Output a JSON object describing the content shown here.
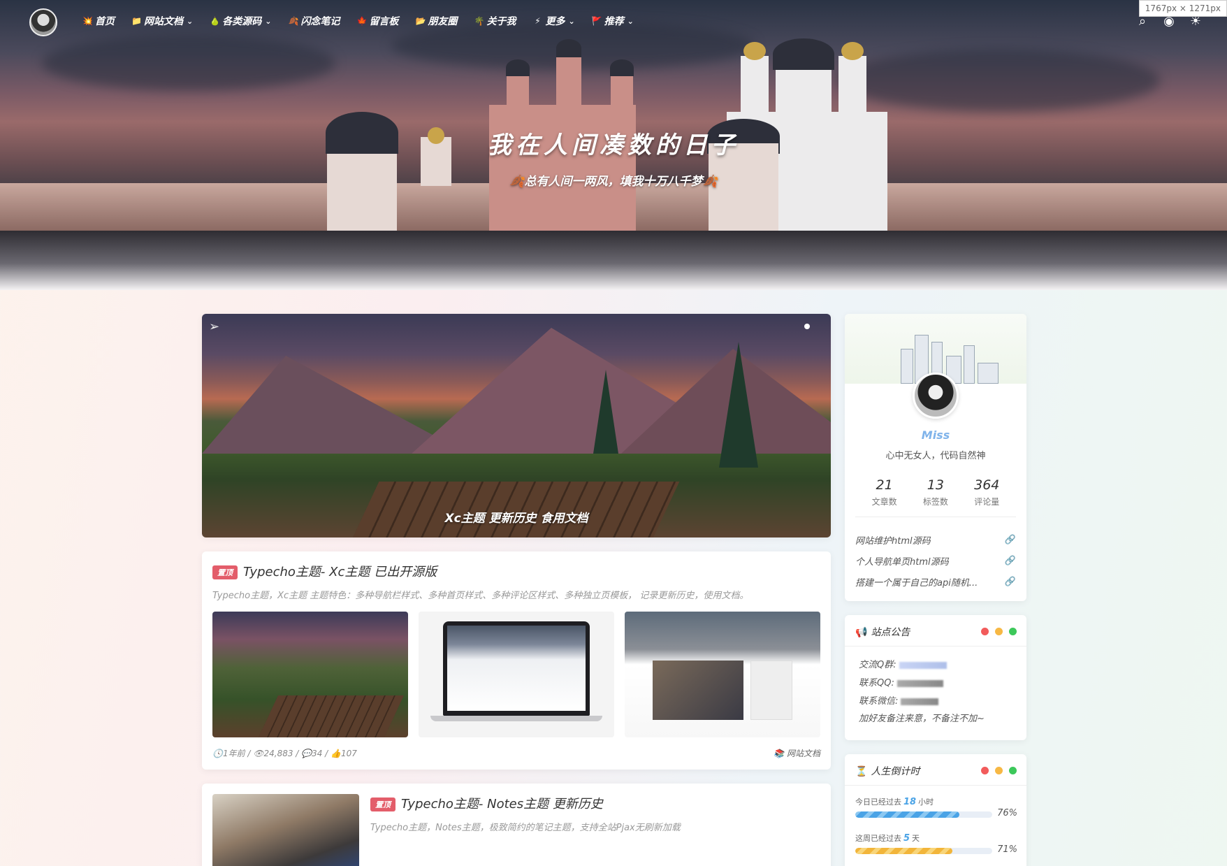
{
  "nav": {
    "items": [
      {
        "label": "首页",
        "icon": "💥",
        "dropdown": false
      },
      {
        "label": "网站文档",
        "icon": "📁",
        "dropdown": true
      },
      {
        "label": "各类源码",
        "icon": "🍐",
        "dropdown": true
      },
      {
        "label": "闪念笔记",
        "icon": "🍂",
        "dropdown": false
      },
      {
        "label": "留言板",
        "icon": "🍁",
        "dropdown": false
      },
      {
        "label": "朋友圈",
        "icon": "📂",
        "dropdown": false
      },
      {
        "label": "关于我",
        "icon": "🌴",
        "dropdown": false
      },
      {
        "label": "更多",
        "icon": "⚡",
        "dropdown": true
      },
      {
        "label": "推荐",
        "icon": "🚩",
        "dropdown": true
      }
    ],
    "chevron": "⌄",
    "tools": {
      "search": "⌕",
      "user": "◉",
      "theme": "☀"
    },
    "size_chip": "1767px × 1271px"
  },
  "hero": {
    "title": "我在人间凑数的日子",
    "subtitle": "🍂总有人间一两风，填我十万八千梦🍂"
  },
  "banner": {
    "caption": "Xc主题 更新历史 食用文档"
  },
  "posts": [
    {
      "badge": "置顶",
      "title": "Typecho主题- Xc主题 已出开源版",
      "desc": "Typecho主题，Xc主题 主题特色：多种导航栏样式、多种首页样式、多种评论区样式、多种独立页模板， 记录更新历史，使用文档。",
      "meta": "🕓1年前 / 👁24,883 / 💬34 / 👍107",
      "category": "网站文档"
    },
    {
      "badge": "置顶",
      "title": "Typecho主题- Notes主题 更新历史",
      "desc": "Typecho主题，Notes主题，极致简约的笔记主题，支持全站Pjax无刷新加载"
    }
  ],
  "profile": {
    "name": "Miss",
    "motto": "心中无女人，代码自然神",
    "stats": [
      {
        "value": "21",
        "label": "文章数"
      },
      {
        "value": "13",
        "label": "标签数"
      },
      {
        "value": "364",
        "label": "评论量"
      }
    ],
    "links": [
      "网站维护html源码",
      "个人导航单页html源码",
      "搭建一个属于自己的api随机..."
    ],
    "link_icon": "🔗"
  },
  "notice": {
    "title": "站点公告",
    "icon": "📢",
    "qq_group": "交流Q群:",
    "qq": "联系QQ:",
    "wechat": "联系微信:",
    "note": "加好友备注来意，不备注不加~"
  },
  "countdown": {
    "title": "人生倒计时",
    "icon": "⏳",
    "rows": [
      {
        "prefix": "今日已经过去",
        "num": "18",
        "unit": "小时",
        "pct_label": "76%",
        "fraction": 0.76
      },
      {
        "prefix": "这周已经过去",
        "num": "5",
        "unit": "天",
        "pct_label": "71%",
        "fraction": 0.71
      }
    ]
  },
  "colors": {
    "dot_red": "#f25b5b",
    "dot_yellow": "#f7b844",
    "dot_green": "#3cc85a",
    "accent": "#4aa3e6",
    "badge": "#e35d6a"
  }
}
